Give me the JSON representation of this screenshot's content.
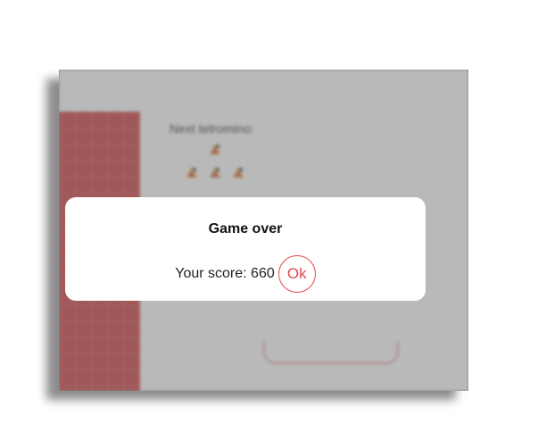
{
  "game": {
    "next_label": "Next tetromino:",
    "next_piece_icon": "flame-block-icon",
    "accent_color": "#e24a4f",
    "board_color": "#c9272b"
  },
  "dialog": {
    "title": "Game over",
    "score_label": "Your score:",
    "score_value": "660",
    "ok_label": "Ok"
  }
}
